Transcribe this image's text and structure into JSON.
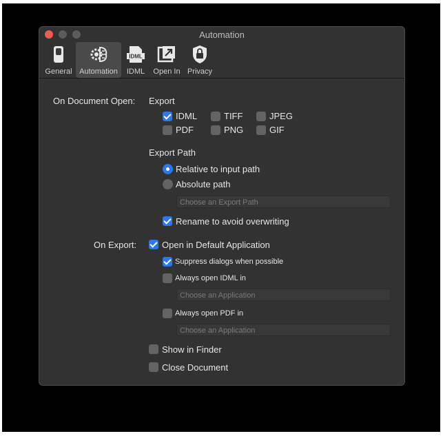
{
  "window": {
    "title": "Automation"
  },
  "toolbar": {
    "items": [
      {
        "label": "General",
        "icon": "toggle-icon"
      },
      {
        "label": "Automation",
        "icon": "brain-gear-icon",
        "selected": true
      },
      {
        "label": "IDML",
        "icon": "idml-file-icon"
      },
      {
        "label": "Open In",
        "icon": "open-in-icon"
      },
      {
        "label": "Privacy",
        "icon": "lock-shield-icon"
      }
    ]
  },
  "document_open": {
    "section_label": "On Document Open:",
    "export_heading": "Export",
    "formats": [
      {
        "label": "IDML",
        "checked": true
      },
      {
        "label": "TIFF",
        "checked": false
      },
      {
        "label": "JPEG",
        "checked": false
      },
      {
        "label": "PDF",
        "checked": false
      },
      {
        "label": "PNG",
        "checked": false
      },
      {
        "label": "GIF",
        "checked": false
      }
    ],
    "export_path_heading": "Export Path",
    "relative_label": "Relative to input path",
    "absolute_label": "Absolute path",
    "export_path_placeholder": "Choose an Export Path",
    "rename_label": "Rename to avoid overwriting"
  },
  "on_export": {
    "section_label": "On Export:",
    "open_default_label": "Open in Default Application",
    "suppress_label": "Suppress dialogs when possible",
    "idml_label": "Always open IDML in",
    "idml_placeholder": "Choose an Application",
    "pdf_label": "Always open PDF in",
    "pdf_placeholder": "Choose an Application",
    "finder_label": "Show in Finder",
    "close_label": "Close Document"
  },
  "colors": {
    "accent": "#2c78e8",
    "close_button": "#ee5b55",
    "window_bg": "#323232"
  }
}
